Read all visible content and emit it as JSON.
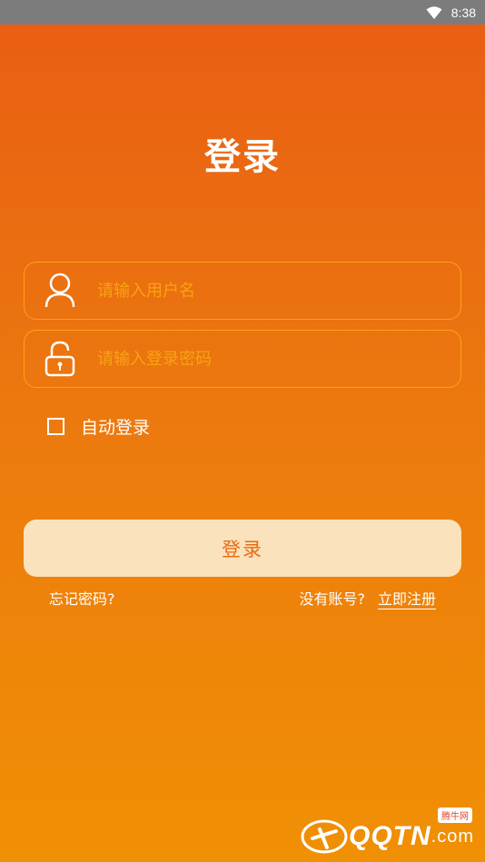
{
  "status_bar": {
    "time": "8:38",
    "wifi_icon": "wifi-icon"
  },
  "page": {
    "title": "登录"
  },
  "form": {
    "username_placeholder": "请输入用户名",
    "password_placeholder": "请输入登录密码",
    "username_icon": "user-icon",
    "password_icon": "lock-icon",
    "auto_login_label": "自动登录",
    "auto_login_checked": false,
    "submit_label": "登录"
  },
  "links": {
    "forgot_password": "忘记密码?",
    "no_account_prompt": "没有账号?",
    "register_now": "立即注册"
  },
  "watermark": {
    "brand": "QQTN",
    "suffix": ".com",
    "badge": "腾牛网"
  },
  "colors": {
    "gradient_top": "#e95d14",
    "gradient_bottom": "#f09004",
    "input_border": "#ffa01c",
    "placeholder": "#f8a312",
    "button_bg": "#fae2bc",
    "button_text": "#ea6a12",
    "status_bar": "#7c7c7c"
  }
}
